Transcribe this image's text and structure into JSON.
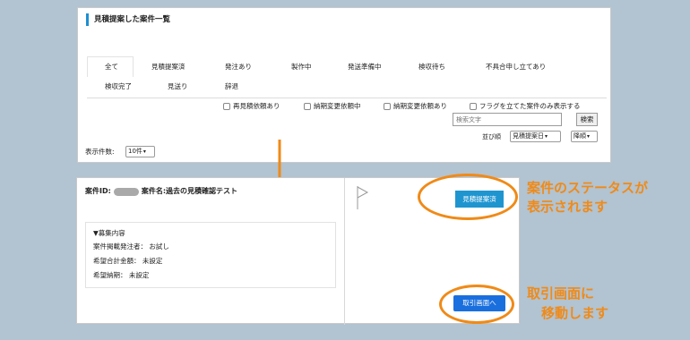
{
  "list_panel": {
    "title": "見積提案した案件一覧",
    "tabs_row1": [
      "全て",
      "見積提案済",
      "発注あり",
      "製作中",
      "発送準備中",
      "検収待ち",
      "不具合申し立てあり"
    ],
    "tabs_row2": [
      "検収完了",
      "見送り",
      "辞退"
    ],
    "active_tab": "全て",
    "filters": [
      "再見積依頼あり",
      "納期変更依頼中",
      "納期変更依頼あり",
      "フラグを立てた案件のみ表示する"
    ],
    "search": {
      "placeholder": "検索文字",
      "button": "検索"
    },
    "sort": {
      "label": "並び順",
      "field": "見積提案日",
      "order": "降順"
    },
    "page_size": {
      "label": "表示件数:",
      "value": "10件"
    }
  },
  "detail_panel": {
    "case_id_label": "案件ID:",
    "case_name": "案件名:過去の見積確認テスト",
    "info_title": "▼募集内容",
    "info_lines": [
      "案件掲載発注者： お試し",
      "希望合計金額： 未設定",
      "希望納期： 未設定"
    ],
    "status_badge": "見積提案済",
    "trade_button": "取引画面へ"
  },
  "callouts": {
    "status": [
      "案件のステータスが",
      "表示されます"
    ],
    "trade": [
      "取引画面に",
      "移動します"
    ]
  },
  "colors": {
    "accent": "#1d8fd1",
    "badge": "#1f95d0",
    "button": "#1a6fde",
    "callout": "#f08a17"
  }
}
